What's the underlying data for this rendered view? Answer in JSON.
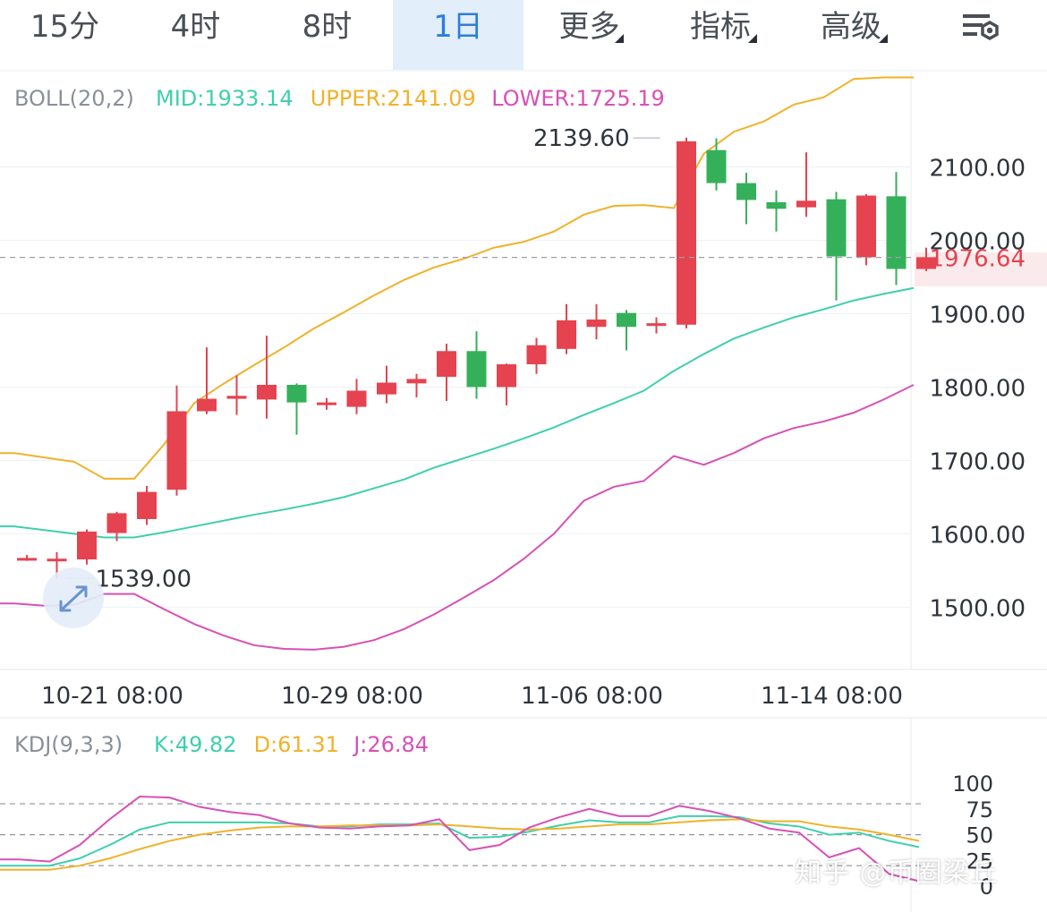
{
  "tabs": [
    {
      "label": "15分",
      "active": false,
      "dropdown": false
    },
    {
      "label": "4时",
      "active": false,
      "dropdown": false
    },
    {
      "label": "8时",
      "active": false,
      "dropdown": false
    },
    {
      "label": "1日",
      "active": true,
      "dropdown": false
    },
    {
      "label": "更多",
      "active": false,
      "dropdown": true
    },
    {
      "label": "指标",
      "active": false,
      "dropdown": true
    },
    {
      "label": "高级",
      "active": false,
      "dropdown": true
    }
  ],
  "settings_icon": "chart-settings-icon",
  "colors": {
    "up": "#e5434f",
    "down": "#35b05a",
    "mid": "#3fcfae",
    "upper": "#f0b22a",
    "lower": "#d751b5",
    "k": "#3fcfae",
    "d": "#f0b22a",
    "j": "#d751b5",
    "accent": "#2b7de0",
    "text": "#4a4f57",
    "axis": "#2f343b"
  },
  "chart_data": [
    {
      "type": "candlestick",
      "indicator": {
        "label": "BOLL(20,2)",
        "mid_label": "MID:1933.14",
        "upper_label": "UPPER:2141.09",
        "lower_label": "LOWER:1725.19"
      },
      "ylim": [
        1415,
        2230
      ],
      "y_ticks": [
        1500,
        1600,
        1700,
        1800,
        1900,
        2000,
        2100
      ],
      "y_tick_labels": [
        "1500.00",
        "1600.00",
        "1700.00",
        "1800.00",
        "1900.00",
        "2000.00",
        "2100.00"
      ],
      "x_labels": [
        "10-21 08:00",
        "10-29 08:00",
        "11-06 08:00",
        "11-14 08:00"
      ],
      "x_label_index": [
        3,
        11,
        19,
        27
      ],
      "last_price": 1976.64,
      "last_price_label": "1976.64",
      "max_marker": {
        "index": 21,
        "value": 2139.6,
        "label": "2139.60"
      },
      "min_marker": {
        "index": 1,
        "value": 1539.0,
        "label": "1539.00"
      },
      "candles": [
        {
          "o": 1567,
          "h": 1571,
          "l": 1563,
          "c": 1567
        },
        {
          "o": 1565,
          "h": 1575,
          "l": 1539,
          "c": 1566
        },
        {
          "o": 1565,
          "h": 1606,
          "l": 1558,
          "c": 1603
        },
        {
          "o": 1601,
          "h": 1630,
          "l": 1590,
          "c": 1628
        },
        {
          "o": 1620,
          "h": 1665,
          "l": 1612,
          "c": 1657
        },
        {
          "o": 1660,
          "h": 1802,
          "l": 1652,
          "c": 1767
        },
        {
          "o": 1767,
          "h": 1854,
          "l": 1763,
          "c": 1784
        },
        {
          "o": 1784,
          "h": 1816,
          "l": 1762,
          "c": 1788
        },
        {
          "o": 1783,
          "h": 1870,
          "l": 1757,
          "c": 1803
        },
        {
          "o": 1803,
          "h": 1805,
          "l": 1735,
          "c": 1779
        },
        {
          "o": 1779,
          "h": 1785,
          "l": 1769,
          "c": 1779
        },
        {
          "o": 1773,
          "h": 1811,
          "l": 1763,
          "c": 1795
        },
        {
          "o": 1790,
          "h": 1829,
          "l": 1778,
          "c": 1806
        },
        {
          "o": 1805,
          "h": 1818,
          "l": 1786,
          "c": 1811
        },
        {
          "o": 1814,
          "h": 1859,
          "l": 1781,
          "c": 1849
        },
        {
          "o": 1849,
          "h": 1876,
          "l": 1784,
          "c": 1800
        },
        {
          "o": 1800,
          "h": 1832,
          "l": 1775,
          "c": 1831
        },
        {
          "o": 1831,
          "h": 1867,
          "l": 1818,
          "c": 1857
        },
        {
          "o": 1852,
          "h": 1913,
          "l": 1845,
          "c": 1891
        },
        {
          "o": 1882,
          "h": 1913,
          "l": 1865,
          "c": 1892
        },
        {
          "o": 1901,
          "h": 1905,
          "l": 1850,
          "c": 1882
        },
        {
          "o": 1884,
          "h": 1895,
          "l": 1873,
          "c": 1887
        },
        {
          "o": 1885,
          "h": 2140,
          "l": 1880,
          "c": 2135
        },
        {
          "o": 2123,
          "h": 2139,
          "l": 2068,
          "c": 2078
        },
        {
          "o": 2078,
          "h": 2092,
          "l": 2022,
          "c": 2055
        },
        {
          "o": 2052,
          "h": 2068,
          "l": 2012,
          "c": 2043
        },
        {
          "o": 2045,
          "h": 2120,
          "l": 2032,
          "c": 2054
        },
        {
          "o": 2056,
          "h": 2066,
          "l": 1918,
          "c": 1978
        },
        {
          "o": 1977,
          "h": 2063,
          "l": 1966,
          "c": 2061
        },
        {
          "o": 2060,
          "h": 2093,
          "l": 1939,
          "c": 1961
        },
        {
          "o": 1961,
          "h": 1990,
          "l": 1958,
          "c": 1977
        }
      ],
      "series": [
        {
          "name": "MID",
          "values": [
            1610,
            1605,
            1600,
            1595,
            1595,
            1602,
            1610,
            1618,
            1626,
            1633,
            1641,
            1650,
            1662,
            1674,
            1690,
            1703,
            1716,
            1730,
            1745,
            1762,
            1778,
            1795,
            1822,
            1845,
            1866,
            1881,
            1895,
            1906,
            1918,
            1927,
            1935
          ]
        },
        {
          "name": "UPPER",
          "values": [
            1710,
            1704,
            1698,
            1675,
            1675,
            1722,
            1778,
            1805,
            1830,
            1854,
            1880,
            1902,
            1925,
            1946,
            1963,
            1975,
            1990,
            1998,
            2012,
            2035,
            2047,
            2048,
            2044,
            2118,
            2148,
            2162,
            2185,
            2195,
            2220,
            2222,
            2222
          ]
        },
        {
          "name": "LOWER",
          "values": [
            1505,
            1502,
            1503,
            1518,
            1518,
            1497,
            1477,
            1461,
            1448,
            1443,
            1442,
            1446,
            1455,
            1470,
            1490,
            1513,
            1537,
            1566,
            1600,
            1645,
            1664,
            1672,
            1706,
            1694,
            1710,
            1730,
            1744,
            1753,
            1765,
            1783,
            1803
          ]
        }
      ]
    },
    {
      "type": "line",
      "indicator": {
        "label": "KDJ(9,3,3)",
        "k_label": "K:49.82",
        "d_label": "D:61.31",
        "j_label": "J:26.84"
      },
      "ylim": [
        -5,
        120
      ],
      "y_ticks": [
        100,
        75,
        50,
        25,
        0
      ],
      "y_tick_labels": [
        "100",
        "75",
        "50",
        "25",
        "0"
      ],
      "dashed_levels": [
        80,
        50,
        20
      ],
      "series": [
        {
          "name": "K",
          "values": [
            20,
            20,
            27,
            40,
            55,
            62,
            62,
            62,
            62,
            61,
            58,
            58,
            60,
            60,
            61,
            47,
            48,
            53,
            59,
            64,
            62,
            62,
            68,
            68,
            67,
            61,
            58,
            50,
            52,
            44,
            38
          ]
        },
        {
          "name": "D",
          "values": [
            16,
            16,
            20,
            27,
            36,
            44,
            50,
            54,
            57,
            58,
            58,
            59,
            59,
            59,
            60,
            58,
            56,
            55,
            56,
            58,
            60,
            60,
            62,
            64,
            65,
            63,
            63,
            58,
            55,
            50,
            44
          ]
        },
        {
          "name": "J",
          "values": [
            26,
            24,
            40,
            65,
            87,
            86,
            77,
            72,
            69,
            61,
            57,
            56,
            58,
            59,
            65,
            35,
            40,
            57,
            67,
            75,
            68,
            68,
            78,
            73,
            66,
            56,
            52,
            28,
            37,
            12,
            5
          ]
        }
      ]
    }
  ],
  "watermark": "知乎 @币圈梁丘"
}
